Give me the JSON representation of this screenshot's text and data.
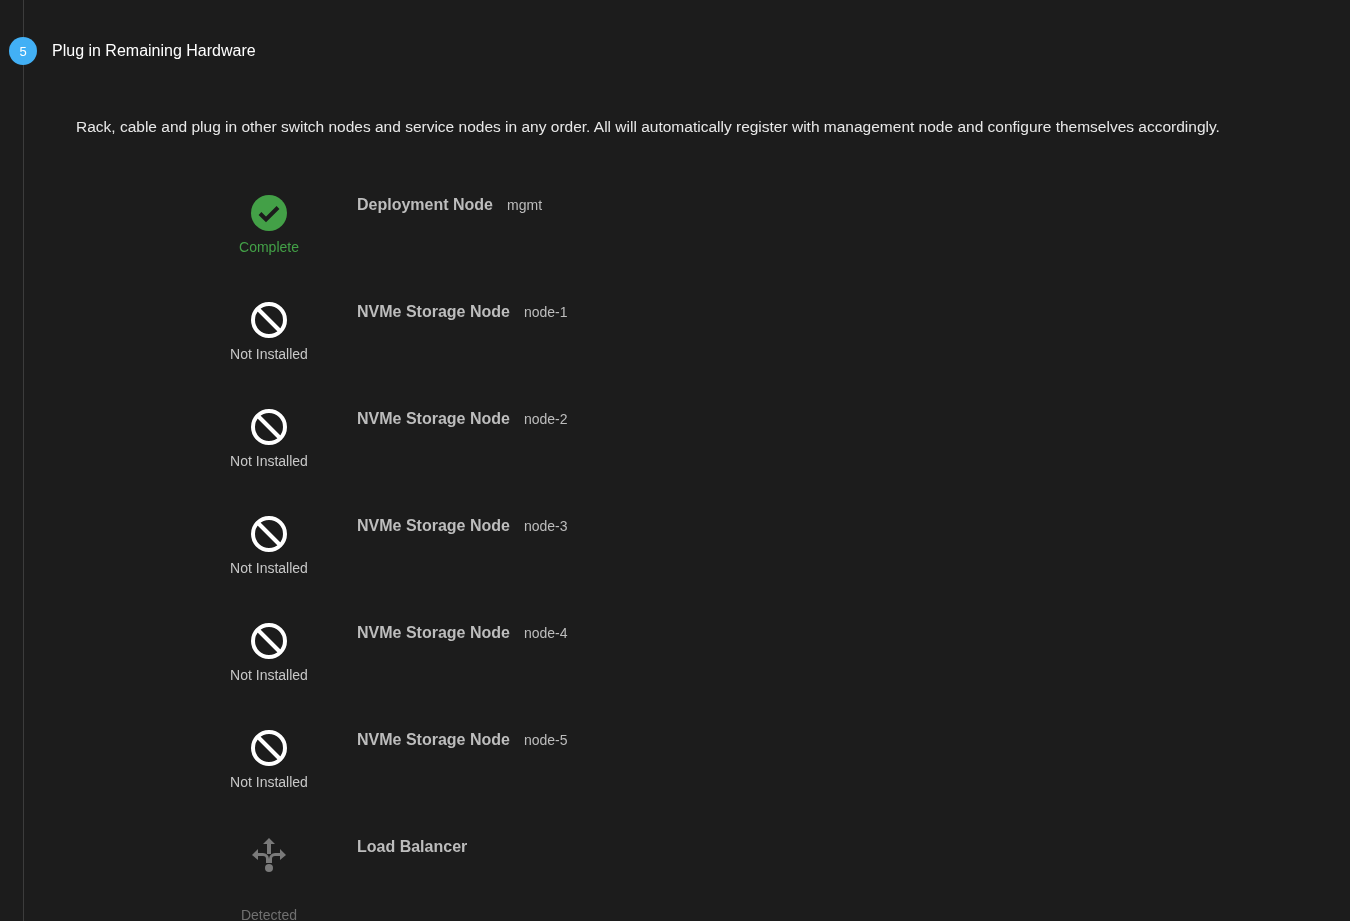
{
  "step": {
    "number": "5",
    "title": "Plug in Remaining Hardware",
    "description": "Rack, cable and plug in other switch nodes and service nodes in any order. All will automatically register with management node and configure themselves accordingly."
  },
  "nodes": [
    {
      "kind": "complete",
      "status_label": "Complete",
      "name": "Deployment Node",
      "host": "mgmt"
    },
    {
      "kind": "missing",
      "status_label": "Not Installed",
      "name": "NVMe Storage Node",
      "host": "node-1"
    },
    {
      "kind": "missing",
      "status_label": "Not Installed",
      "name": "NVMe Storage Node",
      "host": "node-2"
    },
    {
      "kind": "missing",
      "status_label": "Not Installed",
      "name": "NVMe Storage Node",
      "host": "node-3"
    },
    {
      "kind": "missing",
      "status_label": "Not Installed",
      "name": "NVMe Storage Node",
      "host": "node-4"
    },
    {
      "kind": "missing",
      "status_label": "Not Installed",
      "name": "NVMe Storage Node",
      "host": "node-5"
    },
    {
      "kind": "detected",
      "status_label": "Detected",
      "name": "Load Balancer"
    }
  ]
}
